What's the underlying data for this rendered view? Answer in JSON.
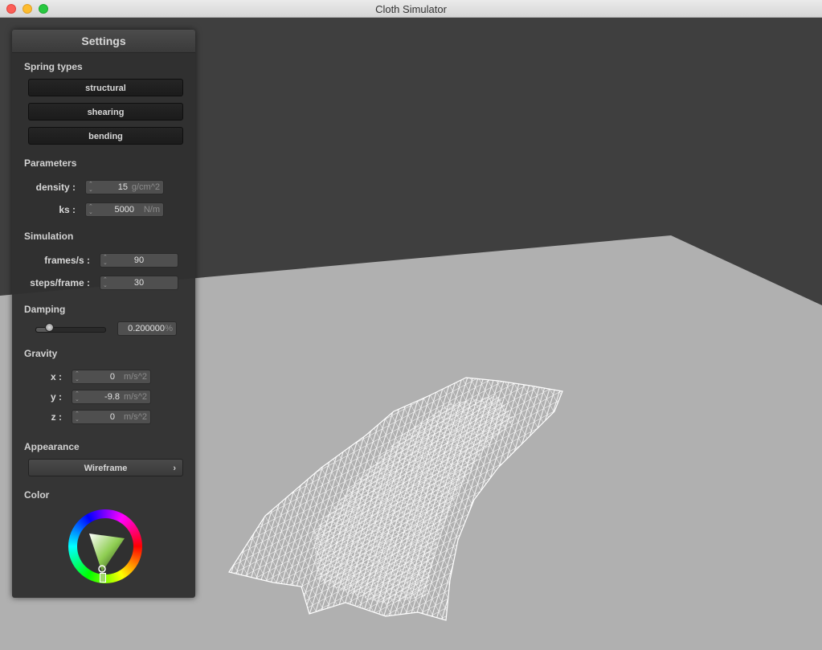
{
  "window": {
    "title": "Cloth Simulator"
  },
  "panel": {
    "title": "Settings",
    "spring_types": {
      "heading": "Spring types",
      "buttons": [
        "structural",
        "shearing",
        "bending"
      ]
    },
    "parameters": {
      "heading": "Parameters",
      "density": {
        "label": "density :",
        "value": "15",
        "unit": "g/cm^2"
      },
      "ks": {
        "label": "ks :",
        "value": "5000",
        "unit": "N/m"
      }
    },
    "simulation": {
      "heading": "Simulation",
      "fps": {
        "label": "frames/s :",
        "value": "90"
      },
      "steps": {
        "label": "steps/frame :",
        "value": "30"
      }
    },
    "damping": {
      "heading": "Damping",
      "value": "0.200000",
      "unit": "%",
      "slider_level": 0.2
    },
    "gravity": {
      "heading": "Gravity",
      "x": {
        "label": "x :",
        "value": "0",
        "unit": "m/s^2"
      },
      "y": {
        "label": "y :",
        "value": "-9.8",
        "unit": "m/s^2"
      },
      "z": {
        "label": "z :",
        "value": "0",
        "unit": "m/s^2"
      }
    },
    "appearance": {
      "heading": "Appearance",
      "selected": "Wireframe"
    },
    "color": {
      "heading": "Color",
      "selected_color": "#9fd66b"
    }
  },
  "scene": {
    "background_color": "#3f3f3f",
    "floor_color": "#b0b0b0",
    "cloth_color": "#ffffff",
    "render_mode": "wireframe"
  }
}
